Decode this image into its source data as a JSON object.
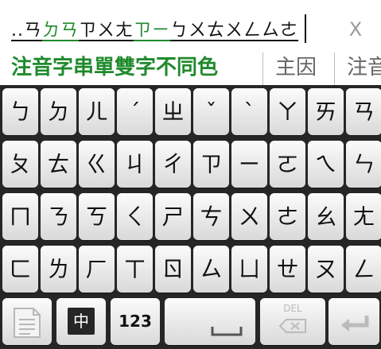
{
  "composing": {
    "segments": [
      {
        "text": "..ㄢ",
        "style": "plain"
      },
      {
        "text": "ㄉㄢ",
        "style": "green"
      },
      {
        "text": "ㄗㄨㄤ",
        "style": "plain"
      },
      {
        "text": "ㄗㄧ",
        "style": "green"
      },
      {
        "text": "ㄅㄨㄊㄨㄥㄙㄜ",
        "style": "plain"
      }
    ],
    "close_label": "X"
  },
  "candidates": {
    "items": [
      "注音字串單雙字不同色",
      "主因",
      "注音"
    ]
  },
  "keyboard": {
    "rows": [
      [
        "ㄅ",
        "ㄉ",
        "ㄦ",
        "ˊ",
        "ㄓ",
        "ˇ",
        "ˋ",
        "ㄚ",
        "ㄞ",
        "ㄢ"
      ],
      [
        "ㄆ",
        "ㄊ",
        "ㄍ",
        "ㄐ",
        "ㄔ",
        "ㄗ",
        "ㄧ",
        "ㄛ",
        "ㄟ",
        "ㄣ"
      ],
      [
        "ㄇ",
        "ㄋ",
        "ㄎ",
        "ㄑ",
        "ㄕ",
        "ㄘ",
        "ㄨ",
        "ㄜ",
        "ㄠ",
        "ㄤ"
      ],
      [
        "ㄈ",
        "ㄌ",
        "ㄏ",
        "ㄒ",
        "ㄖ",
        "ㄙ",
        "ㄩ",
        "ㄝ",
        "ㄡ",
        "ㄥ"
      ]
    ],
    "function_row": {
      "mode_label": "中",
      "numeric_label": "123",
      "delete_label": "DEL"
    }
  }
}
